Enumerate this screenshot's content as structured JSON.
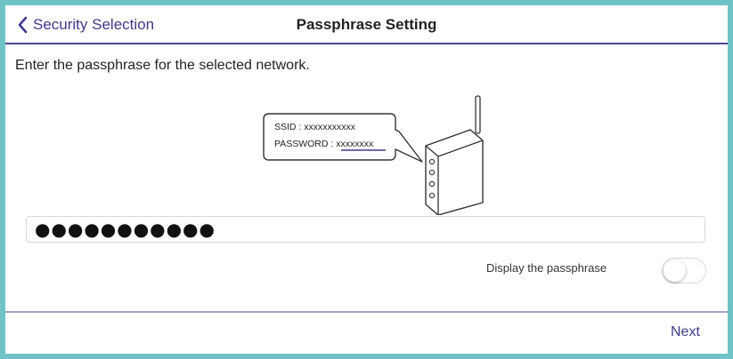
{
  "header": {
    "back_label": "Security Selection",
    "title": "Passphrase Setting"
  },
  "main": {
    "instruction": "Enter the passphrase for the selected network.",
    "illustration": {
      "ssid_line": "SSID : xxxxxxxxxxx",
      "password_label": "PASSWORD : ",
      "password_value": "xxxxxxxx"
    },
    "passphrase_value": "●●●●●●●●●●●",
    "display_passphrase_label": "Display the passphrase",
    "display_passphrase_on": false
  },
  "footer": {
    "next_label": "Next"
  },
  "colors": {
    "frame": "#6fc3c6",
    "accent": "#3d3a8a",
    "header_line": "#47439a"
  }
}
